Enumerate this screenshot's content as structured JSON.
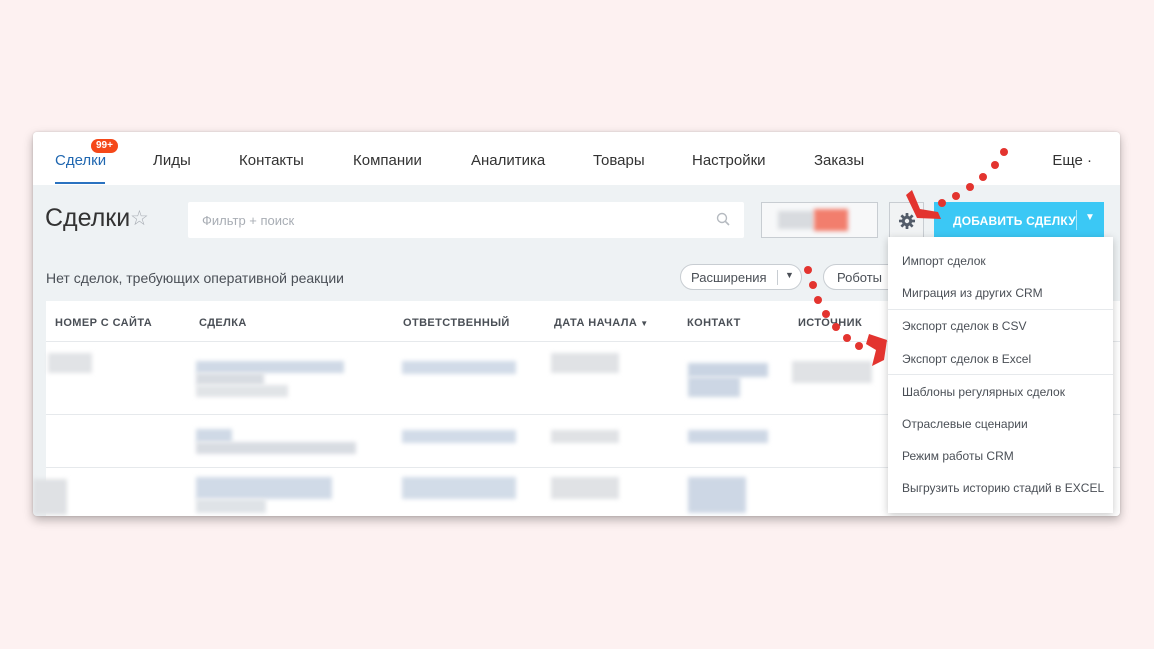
{
  "nav": {
    "tabs": [
      {
        "label": "Сделки"
      },
      {
        "label": "Лиды"
      },
      {
        "label": "Контакты"
      },
      {
        "label": "Компании"
      },
      {
        "label": "Аналитика"
      },
      {
        "label": "Товары"
      },
      {
        "label": "Настройки"
      },
      {
        "label": "Заказы"
      }
    ],
    "badge": "99+",
    "more_label": "Еще ·"
  },
  "header": {
    "title": "Сделки",
    "search_placeholder": "Фильтр + поиск",
    "add_button_label": "ДОБАВИТЬ СДЕЛКУ"
  },
  "subbar": {
    "text": "Нет сделок, требующих оперативной реакции",
    "extensions_label": "Расширения",
    "robots_label": "Роботы"
  },
  "table": {
    "columns": [
      "НОМЕР С САЙТА",
      "СДЕЛКА",
      "ОТВЕТСТВЕННЫЙ",
      "ДАТА НАЧАЛА",
      "КОНТАКТ",
      "ИСТОЧНИК"
    ]
  },
  "menu": {
    "items": [
      {
        "label": "Импорт сделок"
      },
      {
        "label": "Миграция из других CRM"
      },
      {
        "label": "Экспорт сделок в CSV"
      },
      {
        "label": "Экспорт сделок в Excel"
      },
      {
        "label": "Шаблоны регулярных сделок"
      },
      {
        "label": "Отраслевые сценарии"
      },
      {
        "label": "Режим работы CRM"
      },
      {
        "label": "Выгрузить историю стадий в EXCEL"
      }
    ]
  },
  "colors": {
    "accent": "#3bc8f5",
    "active_tab": "#2067b0",
    "badge": "#f54819",
    "annotation": "#e3342f",
    "page_background": "#fdf1f1"
  },
  "icons": [
    "star-icon",
    "search-icon",
    "gear-icon",
    "chevron-down-icon",
    "annotation-arrow-icon"
  ]
}
